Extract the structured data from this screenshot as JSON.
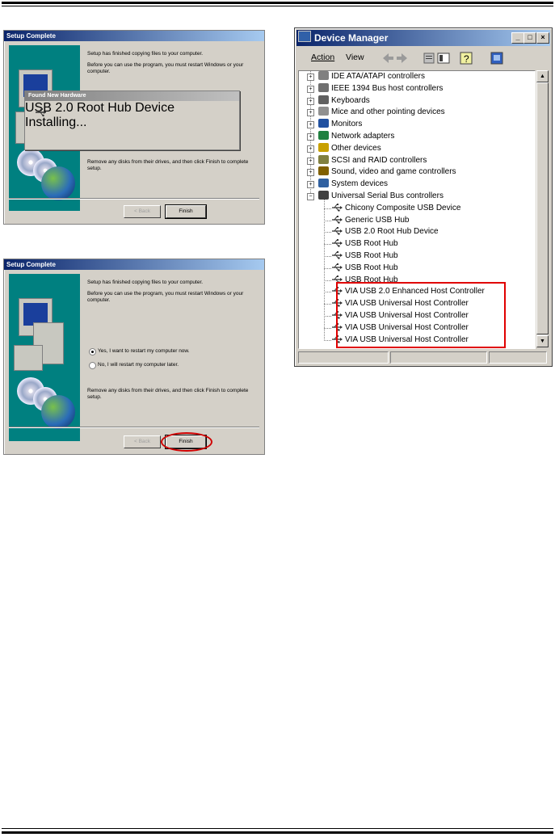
{
  "setup1": {
    "title": "Setup Complete",
    "msg1": "Setup has finished copying files to your computer.",
    "msg2": "Before you can use the program, you must restart Windows or your computer.",
    "msg3": "Remove any disks from their drives, and then click Finish to complete setup.",
    "back": "< Back",
    "finish": "Finish",
    "popup": {
      "title": "Found New Hardware",
      "device": "USB 2.0 Root Hub Device",
      "status": "Installing..."
    }
  },
  "setup2": {
    "title": "Setup Complete",
    "msg1": "Setup has finished copying files to your computer.",
    "msg2": "Before you can use the program, you must restart Windows or your computer.",
    "radio_yes": "Yes, I want to restart my computer now.",
    "radio_no": "No, I will restart my computer later.",
    "msg3": "Remove any disks from their drives, and then click Finish to complete setup.",
    "back": "< Back",
    "finish": "Finish"
  },
  "device_manager": {
    "title": "Device Manager",
    "menu": {
      "action": "Action",
      "view": "View"
    },
    "tree": [
      {
        "label": "IDE ATA/ATAPI controllers",
        "icon": "ide-icon",
        "color": "#808080"
      },
      {
        "label": "IEEE 1394 Bus host controllers",
        "icon": "ieee1394-icon",
        "color": "#707070"
      },
      {
        "label": "Keyboards",
        "icon": "keyboard-icon",
        "color": "#606060"
      },
      {
        "label": "Mice and other pointing devices",
        "icon": "mouse-icon",
        "color": "#909090"
      },
      {
        "label": "Monitors",
        "icon": "monitor-icon",
        "color": "#2050a0"
      },
      {
        "label": "Network adapters",
        "icon": "network-icon",
        "color": "#208040"
      },
      {
        "label": "Other devices",
        "icon": "question-icon",
        "color": "#c8a000"
      },
      {
        "label": "SCSI and RAID controllers",
        "icon": "scsi-icon",
        "color": "#808040"
      },
      {
        "label": "Sound, video and game controllers",
        "icon": "sound-icon",
        "color": "#806000"
      },
      {
        "label": "System devices",
        "icon": "system-icon",
        "color": "#3060a0"
      },
      {
        "label": "Universal Serial Bus controllers",
        "icon": "usb-icon",
        "color": "#404040"
      }
    ],
    "usb_children": [
      "Chicony Composite USB Device",
      "Generic USB Hub",
      "USB 2.0 Root Hub Device",
      "USB Root Hub",
      "USB Root Hub",
      "USB Root Hub",
      "USB Root Hub",
      "VIA USB 2.0 Enhanced Host Controller",
      "VIA USB Universal Host Controller",
      "VIA USB Universal Host Controller",
      "VIA USB Universal Host Controller",
      "VIA USB Universal Host Controller"
    ]
  },
  "colors": {
    "highlight": "#e00000",
    "titlebar": "#0a246a",
    "teal": "#008080"
  }
}
